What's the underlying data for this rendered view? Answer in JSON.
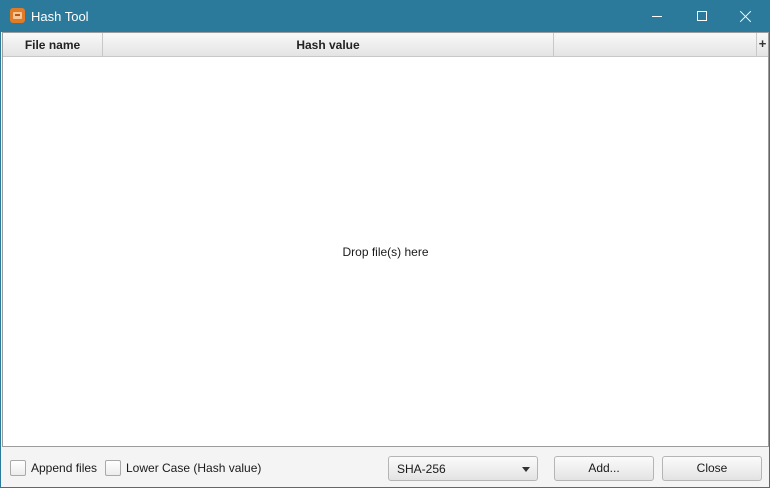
{
  "window": {
    "title": "Hash Tool",
    "icon": "hash-tool-app-icon",
    "controls": [
      "minimize-icon",
      "maximize-icon",
      "close-icon"
    ]
  },
  "table": {
    "columns": [
      "File name",
      "Hash value",
      ""
    ],
    "column_menu_label": "+",
    "placeholder": "Drop file(s) here",
    "rows": []
  },
  "footer": {
    "append_files": {
      "label": "Append files",
      "checked": false
    },
    "lower_case": {
      "label": "Lower Case (Hash value)",
      "checked": false
    },
    "algorithm": {
      "selected": "SHA-256"
    },
    "add_label": "Add...",
    "close_label": "Close"
  },
  "colors": {
    "titlebar": "#2b7a9b",
    "app_icon": "#e07b2a"
  }
}
